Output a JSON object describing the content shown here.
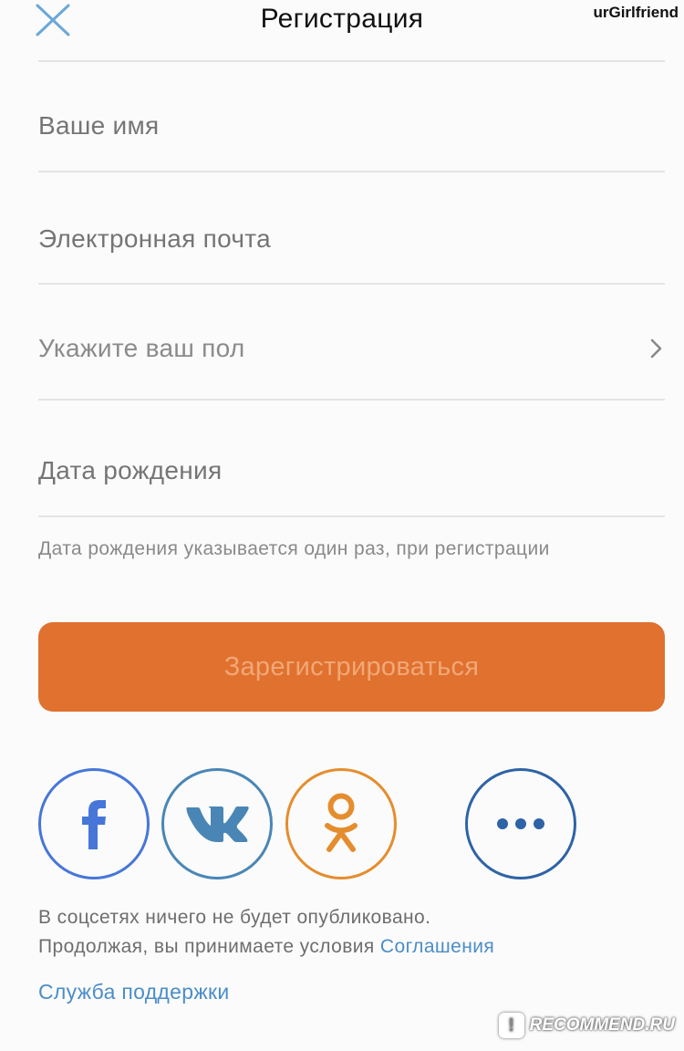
{
  "header": {
    "title": "Регистрация",
    "watermark": "urGirlfriend"
  },
  "form": {
    "name_placeholder": "Ваше имя",
    "email_placeholder": "Электронная почта",
    "gender_label": "Укажите ваш пол",
    "birthdate_placeholder": "Дата рождения",
    "birthdate_hint": "Дата рождения указывается один раз, при регистрации"
  },
  "register_button": "Зарегистрироваться",
  "social": [
    {
      "name": "facebook-icon",
      "color": "#4776d9"
    },
    {
      "name": "vk-icon",
      "color": "#4a86b5"
    },
    {
      "name": "odnoklassniki-icon",
      "color": "#e58d2e"
    },
    {
      "name": "more-icon",
      "color": "#2e63a6"
    }
  ],
  "footer": {
    "line1": "В соцсетях ничего не будет опубликовано.",
    "line2_prefix": "Продолжая, вы принимаете условия",
    "agreement_link": "Соглашения",
    "support_link": "Служба поддержки",
    "watermark": "RECOMMEND.RU"
  },
  "colors": {
    "accent_orange": "#e0712f",
    "link_blue": "#4b8dc8",
    "close_icon": "#6aa8d8"
  }
}
